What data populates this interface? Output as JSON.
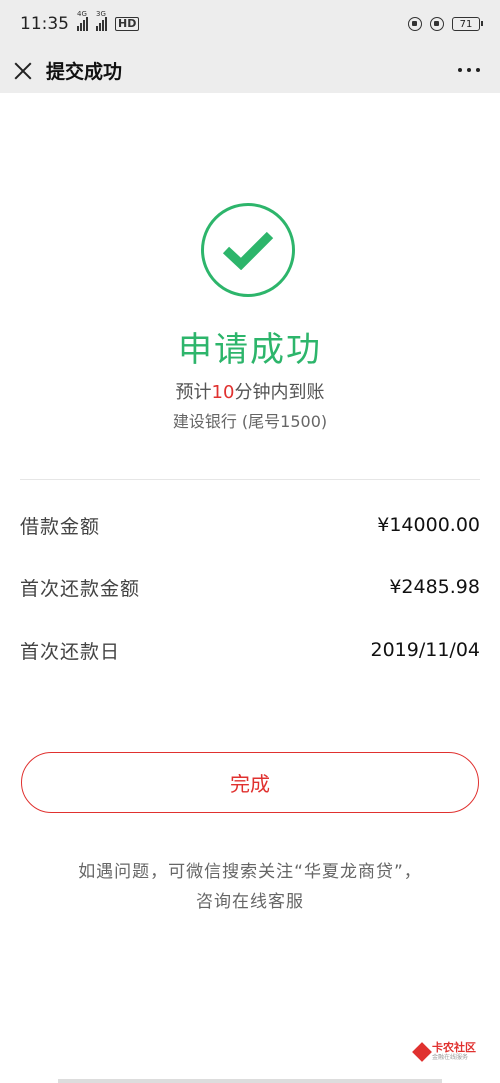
{
  "status": {
    "time": "11:35",
    "net1": "4G",
    "net2": "3G",
    "hd": "HD",
    "battery": "71"
  },
  "nav": {
    "title": "提交成功"
  },
  "result": {
    "title": "申请成功",
    "estimate_prefix": "预计",
    "estimate_minutes": "10",
    "estimate_suffix": "分钟内到账",
    "bank": "建设银行 (尾号1500)"
  },
  "details": [
    {
      "label": "借款金额",
      "value": "¥14000.00"
    },
    {
      "label": "首次还款金额",
      "value": "¥2485.98"
    },
    {
      "label": "首次还款日",
      "value": "2019/11/04"
    }
  ],
  "actions": {
    "done_label": "完成"
  },
  "help": {
    "line1": "如遇问题，可微信搜索关注“华夏龙商贷”，",
    "line2": "咨询在线客服"
  },
  "watermark": {
    "main": "卡农社区",
    "sub": "金融在线服务"
  },
  "colors": {
    "success": "#2db56b",
    "accent": "#e0312f",
    "header_bg": "#ededed"
  }
}
